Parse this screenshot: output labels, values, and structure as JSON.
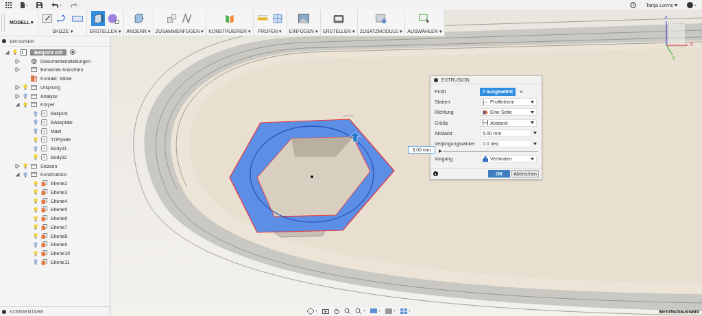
{
  "top_bar": {
    "user": "Tanja Lovric ▾"
  },
  "toolbar": {
    "workspace": "MODELL ▾",
    "groups": [
      {
        "label": "SKIZZE ▾",
        "tools": [
          {
            "selected": false
          },
          {
            "selected": false
          },
          {
            "selected": false
          }
        ]
      },
      {
        "label": "ERSTELLEN ▾",
        "tools": [
          {
            "selected": true
          },
          {
            "selected": false
          }
        ]
      },
      {
        "label": "ÄNDERN ▾",
        "tools": [
          {
            "selected": false
          }
        ]
      },
      {
        "label": "ZUSAMMENFÜGEN ▾",
        "tools": [
          {
            "selected": false
          },
          {
            "selected": false
          }
        ]
      },
      {
        "label": "KONSTRUIEREN ▾",
        "tools": [
          {
            "selected": false
          }
        ]
      },
      {
        "label": "PRÜFEN ▾",
        "tools": [
          {
            "selected": false
          },
          {
            "selected": false
          }
        ]
      },
      {
        "label": "EINFÜGEN ▾",
        "tools": [
          {
            "selected": false
          }
        ]
      },
      {
        "label": "ERSTELLEN ▾",
        "tools": [
          {
            "selected": false
          }
        ]
      },
      {
        "label": "ZUSATZMODULE ▾",
        "tools": [
          {
            "selected": false
          }
        ]
      },
      {
        "label": "AUSWÄHLEN ▾",
        "tools": [
          {
            "selected": false
          }
        ]
      }
    ]
  },
  "browser": {
    "title": "BROWSER",
    "tree": [
      {
        "label": "Balljoint v25",
        "kind": "component",
        "visible": true,
        "expanded": true,
        "selected": true,
        "children": [
          {
            "label": "Dokumenteinstellungen",
            "kind": "settings",
            "expanded": false,
            "selected": false
          },
          {
            "label": "Benannte Ansichten",
            "kind": "folder",
            "expanded": false,
            "selected": false
          },
          {
            "label": "Kontakt: Sätze",
            "kind": "contact",
            "selected": false
          },
          {
            "label": "Ursprung",
            "kind": "folder",
            "visible": true,
            "expanded": false,
            "selected": false
          },
          {
            "label": "Analyse",
            "kind": "folder",
            "visible": false,
            "expanded": false,
            "selected": false
          },
          {
            "label": "Körper",
            "kind": "folder",
            "visible": true,
            "expanded": true,
            "selected": false,
            "children": [
              {
                "label": "Balljoint",
                "kind": "body",
                "visible": false,
                "selected": false
              },
              {
                "label": "BAseplate",
                "kind": "body",
                "visible": false,
                "selected": false
              },
              {
                "label": "Mast",
                "kind": "body",
                "visible": false,
                "selected": false
              },
              {
                "label": "TOPplate",
                "kind": "body",
                "visible": true,
                "selected": false
              },
              {
                "label": "Body31",
                "kind": "body",
                "visible": false,
                "selected": false
              },
              {
                "label": "Body32",
                "kind": "body",
                "visible": true,
                "selected": false
              }
            ]
          },
          {
            "label": "Skizzen",
            "kind": "folder",
            "visible": true,
            "expanded": false,
            "selected": false
          },
          {
            "label": "Konstruktion",
            "kind": "folder",
            "visible": false,
            "expanded": true,
            "selected": false,
            "children": [
              {
                "label": "Ebene2",
                "kind": "plane",
                "visible": true,
                "selected": false
              },
              {
                "label": "Ebene3",
                "kind": "plane",
                "visible": true,
                "selected": false
              },
              {
                "label": "Ebene4",
                "kind": "plane",
                "visible": true,
                "selected": false
              },
              {
                "label": "Ebene5",
                "kind": "plane",
                "visible": true,
                "selected": false
              },
              {
                "label": "Ebene6",
                "kind": "plane",
                "visible": true,
                "selected": false
              },
              {
                "label": "Ebene7",
                "kind": "plane",
                "visible": true,
                "selected": false
              },
              {
                "label": "Ebene8",
                "kind": "plane",
                "visible": true,
                "selected": false
              },
              {
                "label": "Ebene9",
                "kind": "plane",
                "visible": false,
                "selected": false
              },
              {
                "label": "Ebene10",
                "kind": "plane",
                "visible": true,
                "selected": false
              },
              {
                "label": "Ebene11",
                "kind": "plane",
                "visible": false,
                "selected": false
              }
            ]
          }
        ]
      }
    ]
  },
  "comments": {
    "title": "KOMMENTARE"
  },
  "dialog": {
    "title": "EXTRUSION",
    "rows": [
      {
        "label": "Profil",
        "kind": "selection",
        "value": "7 ausgewählt",
        "clear": "×"
      },
      {
        "label": "Starten",
        "kind": "dropdown",
        "value": "Profilebene"
      },
      {
        "label": "Richtung",
        "kind": "dropdown",
        "value": "Eine Seite"
      },
      {
        "label": "Größe",
        "kind": "dropdown",
        "value": "Abstand"
      },
      {
        "label": "Abstand",
        "kind": "input",
        "value": "5.00 mm"
      },
      {
        "label": "Verjüngungswinkel",
        "kind": "input",
        "value": "0.0 deg"
      },
      {
        "kind": "slider",
        "level": 0
      },
      {
        "label": "Vorgang",
        "kind": "dropdown",
        "value": "Verbinden"
      }
    ],
    "ok": "OK",
    "cancel": "Abbrechen"
  },
  "viewport": {
    "distance_field": "5.00 mm",
    "status": "Mehrfachauswahl",
    "axis_labels": {
      "x": "X",
      "y": "Y",
      "z": "Z"
    }
  }
}
